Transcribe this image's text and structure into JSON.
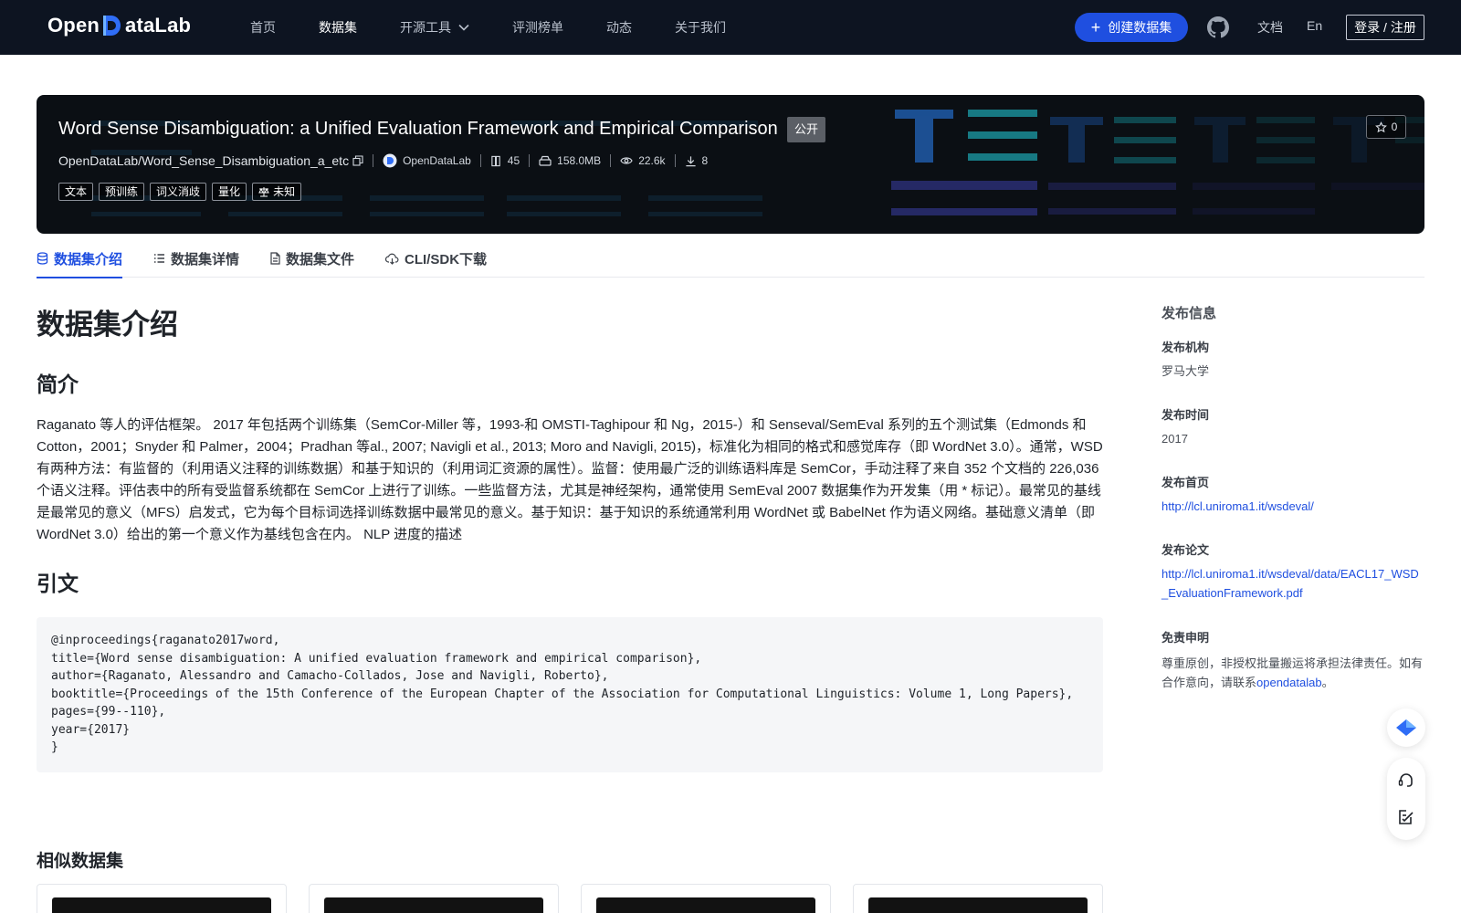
{
  "nav": {
    "logo_pre": "Open",
    "logo_post": "ataLab",
    "items": [
      {
        "label": "首页"
      },
      {
        "label": "数据集"
      },
      {
        "label": "开源工具"
      },
      {
        "label": "评测榜单"
      },
      {
        "label": "动态"
      },
      {
        "label": "关于我们"
      }
    ],
    "create_label": "创建数据集",
    "docs_label": "文档",
    "lang_label": "En",
    "login_label": "登录 / 注册"
  },
  "dataset": {
    "title": "Word Sense Disambiguation: a Unified Evaluation Framework and Empirical Comparison",
    "visibility": "公开",
    "repo": "OpenDataLab/Word_Sense_Disambiguation_a_etc",
    "publisher": "OpenDataLab",
    "likes": "45",
    "size": "158.0MB",
    "views": "22.6k",
    "downloads": "8",
    "stars": "0",
    "tags": [
      "文本",
      "预训练",
      "词义消歧",
      "量化"
    ],
    "license": "未知"
  },
  "tabs": [
    {
      "label": "数据集介绍"
    },
    {
      "label": "数据集详情"
    },
    {
      "label": "数据集文件"
    },
    {
      "label": "CLI/SDK下载"
    }
  ],
  "content": {
    "heading": "数据集介绍",
    "intro_heading": "简介",
    "intro_text": "Raganato 等人的评估框架。 2017 年包括两个训练集（SemCor-Miller 等，1993-和 OMSTI-Taghipour 和 Ng，2015-）和 Senseval/SemEval 系列的五个测试集（Edmonds 和 Cotton，2001；Snyder 和 Palmer，2004；Pradhan 等al., 2007; Navigli et al., 2013; Moro and Navigli, 2015)，标准化为相同的格式和感觉库存（即 WordNet 3.0）。通常，WSD 有两种方法：有监督的（利用语义注释的训练数据）和基于知识的（利用词汇资源的属性）。监督：使用最广泛的训练语料库是 SemCor，手动注释了来自 352 个文档的 226,036 个语义注释。评估表中的所有受监督系统都在 SemCor 上进行了训练。一些监督方法，尤其是神经架构，通常使用 SemEval 2007 数据集作为开发集（用 * 标记）。最常见的基线是最常见的意义（MFS）启发式，它为每个目标词选择训练数据中最常见的意义。基于知识：基于知识的系统通常利用 WordNet 或 BabelNet 作为语义网络。基础意义清单（即 WordNet 3.0）给出的第一个意义作为基线包含在内。 NLP 进度的描述",
    "citation_heading": "引文",
    "citation": "@inproceedings{raganato2017word,\ntitle={Word sense disambiguation: A unified evaluation framework and empirical comparison},\nauthor={Raganato, Alessandro and Camacho-Collados, Jose and Navigli, Roberto},\nbooktitle={Proceedings of the 15th Conference of the European Chapter of the Association for Computational Linguistics: Volume 1, Long Papers},\npages={99--110},\nyear={2017}\n}",
    "similar_heading": "相似数据集"
  },
  "sidebar": {
    "title": "发布信息",
    "org_label": "发布机构",
    "org_value": "罗马大学",
    "time_label": "发布时间",
    "time_value": "2017",
    "homepage_label": "发布首页",
    "homepage_value": "http://lcl.uniroma1.it/wsdeval/",
    "paper_label": "发布论文",
    "paper_value": "http://lcl.uniroma1.it/wsdeval/data/EACL17_WSD_EvaluationFramework.pdf",
    "disclaimer_label": "免责申明",
    "disclaimer_text": "尊重原创，非授权批量搬运将承担法律责任。如有合作意向，请联系",
    "disclaimer_link": "opendatalab",
    "disclaimer_end": "。"
  },
  "colors": {
    "nav_bg": "#0d1421",
    "accent": "#1f4fe0",
    "banner_bg": "#0b0f14"
  }
}
